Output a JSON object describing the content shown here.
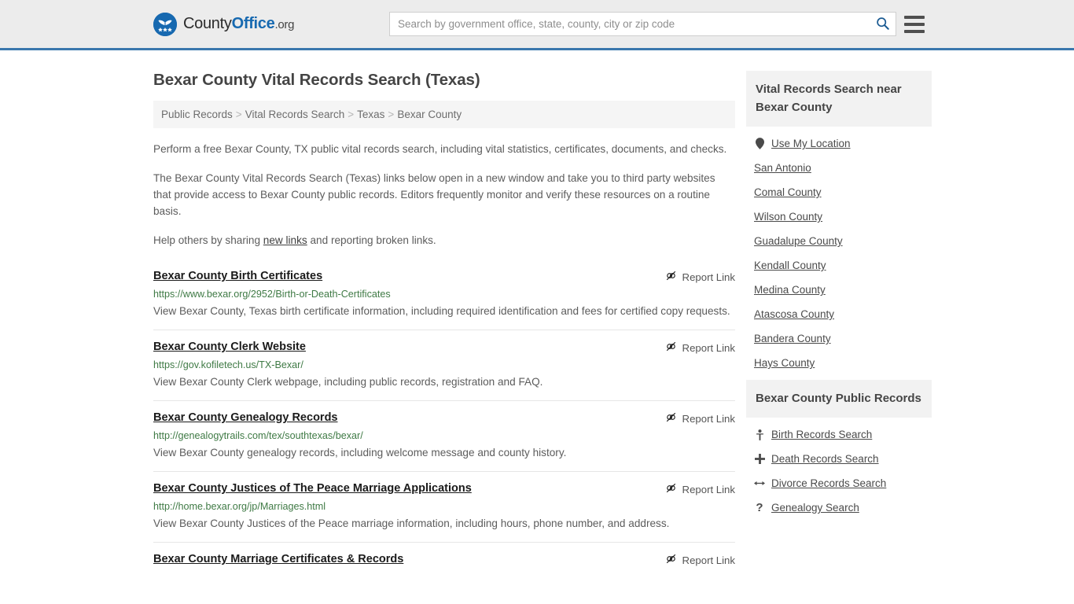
{
  "header": {
    "brand": {
      "name_part1": "County",
      "name_part2": "Office",
      "name_suffix": ".org",
      "logo_icon": "eagle-shield-logo"
    },
    "search": {
      "placeholder": "Search by government office, state, county, city or zip code",
      "value": "",
      "search_icon": "search-icon"
    },
    "menu_icon": "hamburger-menu-icon",
    "accent_color": "#3a77ad"
  },
  "page_title": "Bexar County Vital Records Search (Texas)",
  "breadcrumb": {
    "items": [
      {
        "label": "Public Records"
      },
      {
        "label": "Vital Records Search"
      },
      {
        "label": "Texas"
      },
      {
        "label": "Bexar County"
      }
    ],
    "separator": ">"
  },
  "intro": {
    "paragraph1": "Perform a free Bexar County, TX public vital records search, including vital statistics, certificates, documents, and checks.",
    "paragraph2": "The Bexar County Vital Records Search (Texas) links below open in a new window and take you to third party websites that provide access to Bexar County public records. Editors frequently monitor and verify these resources on a routine basis.",
    "paragraph3_before": "Help others by sharing ",
    "paragraph3_link": "new links",
    "paragraph3_after": " and reporting broken links."
  },
  "results": {
    "report_label": "Report Link",
    "report_icon": "broken-link-icon",
    "items": [
      {
        "title": "Bexar County Birth Certificates",
        "url": "https://www.bexar.org/2952/Birth-or-Death-Certificates",
        "description": "View Bexar County, Texas birth certificate information, including required identification and fees for certified copy requests."
      },
      {
        "title": "Bexar County Clerk Website",
        "url": "https://gov.kofiletech.us/TX-Bexar/",
        "description": "View Bexar County Clerk webpage, including public records, registration and FAQ."
      },
      {
        "title": "Bexar County Genealogy Records",
        "url": "http://genealogytrails.com/tex/southtexas/bexar/",
        "description": "View Bexar County genealogy records, including welcome message and county history."
      },
      {
        "title": "Bexar County Justices of The Peace Marriage Applications",
        "url": "http://home.bexar.org/jp/Marriages.html",
        "description": "View Bexar County Justices of the Peace marriage information, including hours, phone number, and address."
      },
      {
        "title": "Bexar County Marriage Certificates & Records",
        "url": "",
        "description": ""
      }
    ]
  },
  "sidebar": {
    "nearby": {
      "heading": "Vital Records Search near Bexar County",
      "use_my_location": "Use My Location",
      "location_icon": "map-pin-icon",
      "places": [
        "San Antonio",
        "Comal County",
        "Wilson County",
        "Guadalupe County",
        "Kendall County",
        "Medina County",
        "Atascosa County",
        "Bandera County",
        "Hays County"
      ]
    },
    "public_records": {
      "heading": "Bexar County Public Records",
      "items": [
        {
          "label": "Birth Records Search",
          "icon": "baby-icon",
          "glyph": "♀"
        },
        {
          "label": "Death Records Search",
          "icon": "cross-icon",
          "glyph": "✚"
        },
        {
          "label": "Divorce Records Search",
          "icon": "split-arrows-icon",
          "glyph": "↔"
        },
        {
          "label": "Genealogy Search",
          "icon": "question-mark-icon",
          "glyph": "?"
        }
      ]
    }
  }
}
